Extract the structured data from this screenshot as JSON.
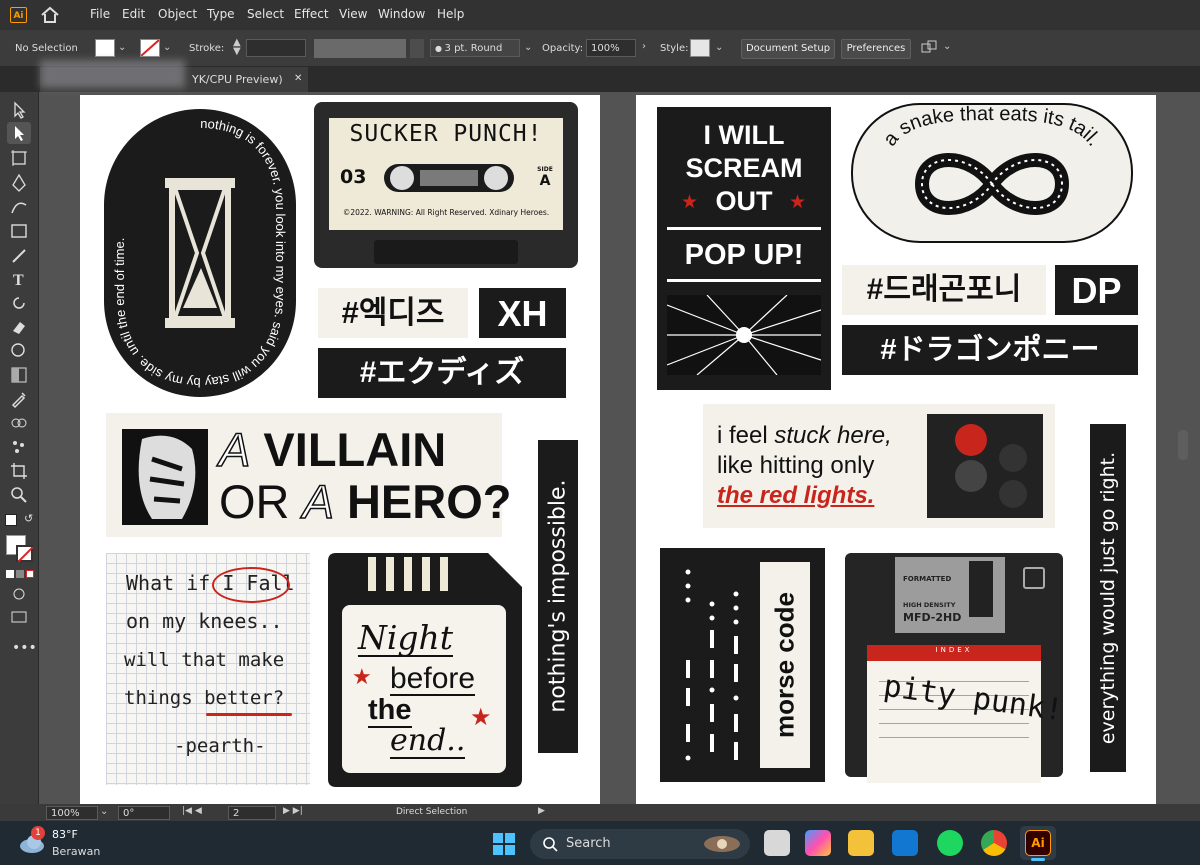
{
  "app": {
    "logo": "Ai"
  },
  "menu": [
    "File",
    "Edit",
    "Object",
    "Type",
    "Select",
    "Effect",
    "View",
    "Window",
    "Help"
  ],
  "control": {
    "selection": "No Selection",
    "stroke_label": "Stroke:",
    "brush": "3 pt. Round",
    "opacity_label": "Opacity:",
    "opacity": "100%",
    "style_label": "Style:",
    "doc_setup": "Document Setup",
    "preferences": "Preferences"
  },
  "tab": {
    "title": "YK/CPU Preview)",
    "close": "✕"
  },
  "stickers": {
    "oval_text": "nothing is forever. you look into my eyes. said you will stay by my side. until the end of time.",
    "cassette_title": "SUCKER PUNCH!",
    "cassette_num": "03",
    "cassette_side_label": "SIDE",
    "cassette_side": "A",
    "cassette_warning": "©2022. WARNING: All Right Reserved. Xdinary Heroes.",
    "tag_kr": "#엑디즈",
    "tag_xh": "XH",
    "tag_jp": "#エクディズ",
    "villain_line1_a": "A",
    "villain_line1_b": "VILLAIN",
    "villain_line2_a": "OR",
    "villain_line2_b": "A",
    "villain_line2_c": "HERO?",
    "impossible": "nothing's impossible.",
    "note_l1": "What if I Fall",
    "note_l2": "on my knees..",
    "note_l3": "will that make",
    "note_l4": "things better?",
    "note_l5": "-pearth-",
    "sd_night": "Night",
    "sd_before": "before",
    "sd_the": "the",
    "sd_end": "end..",
    "scream_l1": "I WILL",
    "scream_l2": "SCREAM",
    "scream_l3": "OUT",
    "popup": "POP UP!",
    "snake": "a snake that eats its tail.",
    "tag_dp_kr": "#드래곤포니",
    "tag_dp": "DP",
    "tag_dp_jp": "#ドラゴンポニー",
    "stuck_l1a": "i feel ",
    "stuck_l1b": "stuck here,",
    "stuck_l2": "like hitting only",
    "stuck_l3": "the red lights.",
    "morse": "morse code",
    "floppy_formatted": "FORMATTED",
    "floppy_density": "HIGH DENSITY",
    "floppy_model": "MFD-2HD",
    "floppy_index": "INDEX",
    "floppy_text": "pity punk!",
    "right_vertical": "everything would just go right."
  },
  "status": {
    "zoom": "100%",
    "rotate": "0°",
    "page": "2",
    "tool": "Direct Selection"
  },
  "taskbar": {
    "temp": "83°F",
    "weather": "Berawan",
    "search": "Search",
    "badge": "1"
  }
}
